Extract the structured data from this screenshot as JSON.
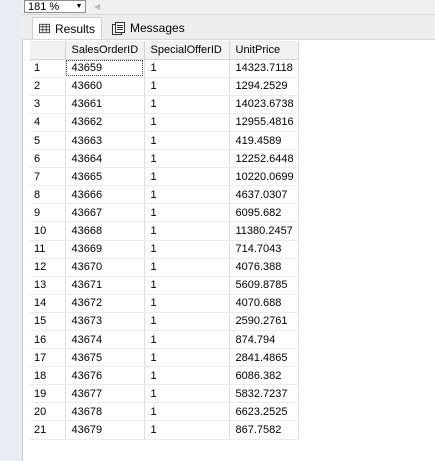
{
  "zoom": {
    "value": "181 %"
  },
  "tabs": [
    {
      "label": "Results",
      "icon": "grid-icon"
    },
    {
      "label": "Messages",
      "icon": "messages-icon"
    }
  ],
  "grid": {
    "columns": [
      "",
      "SalesOrderID",
      "SpecialOfferID",
      "UnitPrice"
    ],
    "rows": [
      [
        "1",
        "43659",
        "1",
        "14323.7118"
      ],
      [
        "2",
        "43660",
        "1",
        "1294.2529"
      ],
      [
        "3",
        "43661",
        "1",
        "14023.6738"
      ],
      [
        "4",
        "43662",
        "1",
        "12955.4816"
      ],
      [
        "5",
        "43663",
        "1",
        "419.4589"
      ],
      [
        "6",
        "43664",
        "1",
        "12252.6448"
      ],
      [
        "7",
        "43665",
        "1",
        "10220.0699"
      ],
      [
        "8",
        "43666",
        "1",
        "4637.0307"
      ],
      [
        "9",
        "43667",
        "1",
        "6095.682"
      ],
      [
        "10",
        "43668",
        "1",
        "11380.2457"
      ],
      [
        "11",
        "43669",
        "1",
        "714.7043"
      ],
      [
        "12",
        "43670",
        "1",
        "4076.388"
      ],
      [
        "13",
        "43671",
        "1",
        "5609.8785"
      ],
      [
        "14",
        "43672",
        "1",
        "4070.688"
      ],
      [
        "15",
        "43673",
        "1",
        "2590.2761"
      ],
      [
        "16",
        "43674",
        "1",
        "874.794"
      ],
      [
        "17",
        "43675",
        "1",
        "2841.4865"
      ],
      [
        "18",
        "43676",
        "1",
        "6086.382"
      ],
      [
        "19",
        "43677",
        "1",
        "5832.7237"
      ],
      [
        "20",
        "43678",
        "1",
        "6623.2525"
      ],
      [
        "21",
        "43679",
        "1",
        "867.7582"
      ]
    ]
  }
}
